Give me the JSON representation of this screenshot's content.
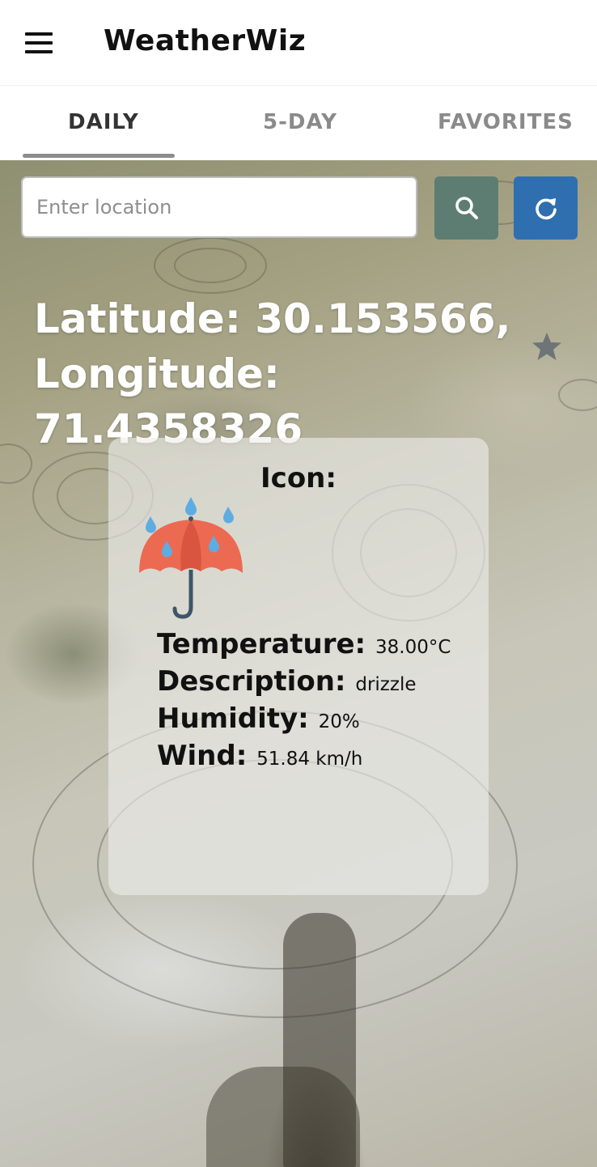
{
  "app": {
    "title": "WeatherWiz"
  },
  "tabs": [
    {
      "label": "DAILY",
      "active": true
    },
    {
      "label": "5-DAY",
      "active": false
    },
    {
      "label": "FAVORITES",
      "active": false
    }
  ],
  "search": {
    "placeholder": "Enter location",
    "value": ""
  },
  "location": {
    "latitude_line": "Latitude: 30.153566,",
    "longitude_line": "Longitude: 71.4358326"
  },
  "weather": {
    "icon_label": "Icon:",
    "icon_name": "umbrella-rain-icon",
    "temperature_label": "Temperature:",
    "temperature_value": "38.00°C",
    "description_label": "Description:",
    "description_value": "drizzle",
    "humidity_label": "Humidity:",
    "humidity_value": "20%",
    "wind_label": "Wind:",
    "wind_value": "51.84 km/h"
  },
  "icons": {
    "menu": "menu-icon",
    "search": "search-icon",
    "refresh": "refresh-icon",
    "favorite": "star-icon"
  },
  "colors": {
    "search_button": "#5e7d72",
    "refresh_button": "#2f6fb0",
    "tab_indicator": "#8d8d8d",
    "star": "#6f7478"
  }
}
